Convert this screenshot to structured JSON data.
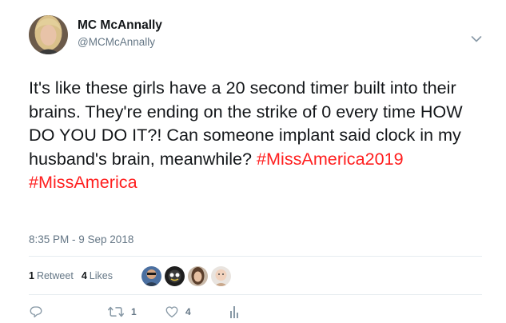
{
  "tweet": {
    "author": {
      "display_name": "MC McAnnally",
      "handle": "@MCMcAnnally"
    },
    "text_plain": "It's like these girls have a 20 second timer built into their brains. They're ending on the strike of 0 every time HOW DO YOU DO IT?! Can someone implant said clock in my husband's brain, meanwhile?",
    "hashtags": [
      "#MissAmerica2019",
      "#MissAmerica"
    ],
    "timestamp": "8:35 PM - 9 Sep 2018",
    "stats": {
      "retweets_count": "1",
      "retweets_label": "Retweet",
      "likes_count": "4",
      "likes_label": "Likes"
    },
    "likers": [
      "liker-1",
      "liker-2",
      "liker-3",
      "liker-4"
    ],
    "actions": {
      "reply_count": "",
      "retweet_count": "1",
      "like_count": "4"
    },
    "icons": {
      "menu": "chevron-down-icon",
      "reply": "reply-icon",
      "retweet": "retweet-icon",
      "like": "heart-icon",
      "analytics": "analytics-icon"
    },
    "colors": {
      "hashtag": "#ff1f1f",
      "secondary_text": "#657786",
      "primary_text": "#14171a",
      "divider": "#e6ecf0"
    }
  }
}
